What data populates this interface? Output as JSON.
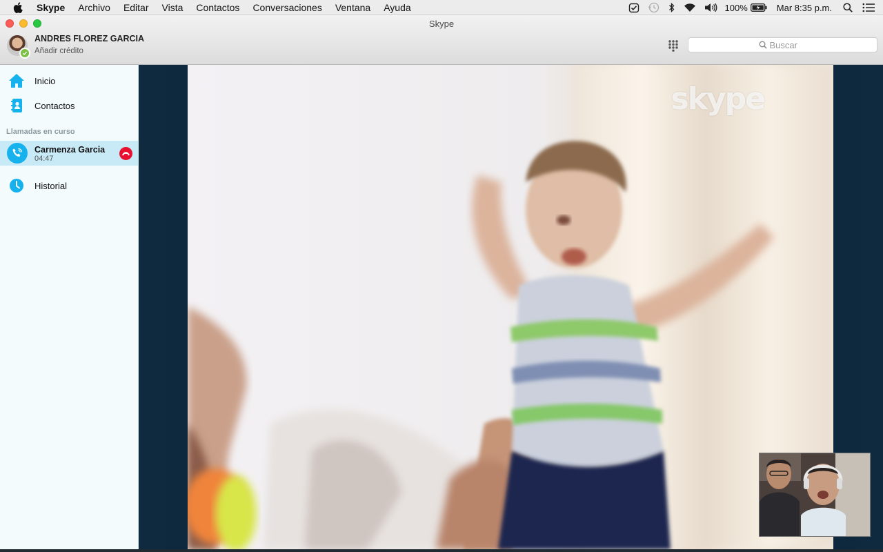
{
  "menubar": {
    "items": [
      "Skype",
      "Archivo",
      "Editar",
      "Vista",
      "Contactos",
      "Conversaciones",
      "Ventana",
      "Ayuda"
    ],
    "battery": "100%",
    "clock": "Mar 8:35 p.m."
  },
  "window": {
    "title": "Skype"
  },
  "profile": {
    "name": "ANDRES FLOREZ GARCIA",
    "subtitle": "Añadir crédito",
    "status_color": "#7bc144"
  },
  "search": {
    "placeholder": "Buscar"
  },
  "sidebar": {
    "nav": [
      {
        "label": "Inicio",
        "icon": "home-icon"
      },
      {
        "label": "Contactos",
        "icon": "contacts-icon"
      }
    ],
    "section_label": "Llamadas en curso",
    "active_call": {
      "name": "Carmenza Garcia",
      "duration": "04:47"
    },
    "history": {
      "label": "Historial",
      "icon": "clock-icon"
    }
  },
  "video": {
    "watermark": "skype"
  },
  "colors": {
    "accent": "#16b2ed",
    "hangup": "#e8102e",
    "active_row": "#c8eaf6",
    "video_bg": "#0a2236"
  }
}
